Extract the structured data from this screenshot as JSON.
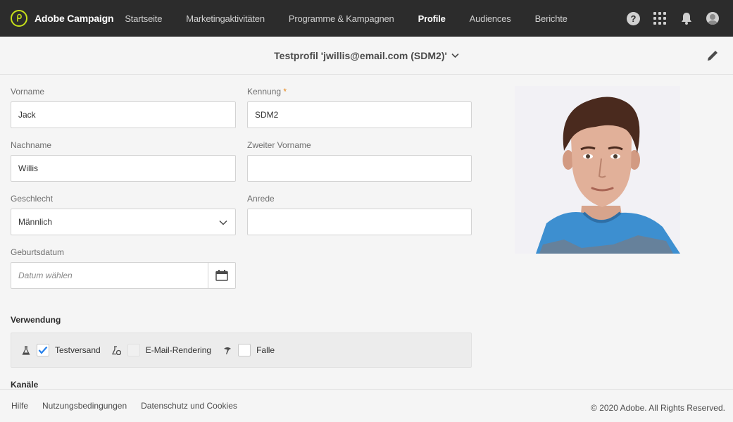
{
  "app": {
    "brand_name": "Adobe Campaign",
    "brand_icon": "adobe-campaign-logo",
    "accent_color": "#c7e019"
  },
  "nav": {
    "items": [
      {
        "label": "Startseite"
      },
      {
        "label": "Marketingaktivitäten"
      },
      {
        "label": "Programme & Kampagnen"
      },
      {
        "label": "Profile"
      },
      {
        "label": "Audiences"
      },
      {
        "label": "Berichte"
      }
    ],
    "active": "Profile",
    "right_icons": [
      "help-icon",
      "apps-grid-icon",
      "bell-icon",
      "user-avatar-icon"
    ]
  },
  "header": {
    "title": "Testprofil 'jwillis@email.com (SDM2)'",
    "edit_icon": "pencil-icon"
  },
  "form": {
    "firstname": {
      "label": "Vorname",
      "value": "Jack"
    },
    "id": {
      "label": "Kennung",
      "required_mark": "*",
      "value": "SDM2"
    },
    "lastname": {
      "label": "Nachname",
      "value": "Willis"
    },
    "middlename": {
      "label": "Zweiter Vorname",
      "value": ""
    },
    "gender": {
      "label": "Geschlecht",
      "value": "Männlich"
    },
    "salutation": {
      "label": "Anrede",
      "value": ""
    },
    "birthdate": {
      "label": "Geburtsdatum",
      "placeholder": "Datum wählen"
    }
  },
  "usage": {
    "title": "Verwendung",
    "items": [
      {
        "label": "Testversand",
        "checked": true,
        "icon": "flask-icon"
      },
      {
        "label": "E-Mail-Rendering",
        "checked": false,
        "disabled": true,
        "icon": "flask-email-icon"
      },
      {
        "label": "Falle",
        "checked": false,
        "icon": "trap-icon"
      }
    ]
  },
  "channels": {
    "title": "Kanäle"
  },
  "footer": {
    "links": [
      "Hilfe",
      "Nutzungsbedingungen",
      "Datenschutz und Cookies"
    ],
    "copyright": "© 2020 Adobe. All Rights Reserved."
  }
}
